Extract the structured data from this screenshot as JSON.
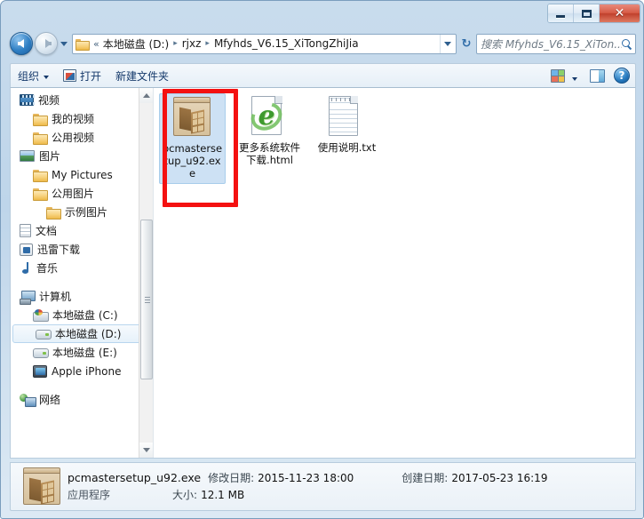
{
  "window": {
    "buttons": {
      "minimize": "–",
      "maximize": "□",
      "close": "✕"
    }
  },
  "address": {
    "back_tooltip": "后退",
    "forward_tooltip": "前进",
    "separator_first": "«",
    "separator": "▸",
    "crumbs": [
      "本地磁盘 (D:)",
      "rjxz",
      "Mfyhds_V6.15_XiTongZhiJia"
    ],
    "refresh": "↻"
  },
  "search": {
    "placeholder": "搜索 Mfyhds_V6.15_XiTon..."
  },
  "toolbar": {
    "organize": "组织",
    "open": "打开",
    "new_folder": "新建文件夹"
  },
  "sidebar": {
    "items": [
      {
        "label": "视频",
        "icon": "video-icon",
        "indent": 0,
        "selected": false
      },
      {
        "label": "我的视频",
        "icon": "folder-icon",
        "indent": 1,
        "selected": false
      },
      {
        "label": "公用视频",
        "icon": "folder-icon",
        "indent": 1,
        "selected": false
      },
      {
        "label": "图片",
        "icon": "pictures-icon",
        "indent": 0,
        "selected": false
      },
      {
        "label": "My Pictures",
        "icon": "folder-icon",
        "indent": 1,
        "selected": false
      },
      {
        "label": "公用图片",
        "icon": "folder-icon",
        "indent": 1,
        "selected": false
      },
      {
        "label": "示例图片",
        "icon": "folder-icon",
        "indent": 2,
        "selected": false
      },
      {
        "label": "文档",
        "icon": "document-icon",
        "indent": 0,
        "selected": false
      },
      {
        "label": "迅雷下载",
        "icon": "download-icon",
        "indent": 0,
        "selected": false
      },
      {
        "label": "音乐",
        "icon": "music-icon",
        "indent": 0,
        "selected": false
      },
      {
        "label": "计算机",
        "icon": "computer-icon",
        "indent": 0,
        "selected": false,
        "gap_before": true
      },
      {
        "label": "本地磁盘 (C:)",
        "icon": "system-drive-icon",
        "indent": 1,
        "selected": false
      },
      {
        "label": "本地磁盘 (D:)",
        "icon": "drive-icon",
        "indent": 1,
        "selected": true
      },
      {
        "label": "本地磁盘 (E:)",
        "icon": "drive-icon",
        "indent": 1,
        "selected": false
      },
      {
        "label": "Apple iPhone",
        "icon": "iphone-icon",
        "indent": 1,
        "selected": false
      },
      {
        "label": "网络",
        "icon": "network-icon",
        "indent": 0,
        "selected": false,
        "gap_before": true
      }
    ]
  },
  "files": [
    {
      "name": "pcmastersetup_u92.exe",
      "icon": "exe-icon",
      "selected": true
    },
    {
      "name": "更多系统软件下载.html",
      "icon": "html-icon",
      "selected": false
    },
    {
      "name": "使用说明.txt",
      "icon": "txt-icon",
      "selected": false
    }
  ],
  "status": {
    "file_name": "pcmastersetup_u92.exe",
    "file_type": "应用程序",
    "modified_label": "修改日期:",
    "modified_value": "2015-11-23 18:00",
    "created_label": "创建日期:",
    "created_value": "2017-05-23 16:19",
    "size_label": "大小:",
    "size_value": "12.1 MB"
  },
  "colors": {
    "annotation_red": "#f41111",
    "selection_blue": "#cde1f4",
    "close_button_red": "#c0402c"
  }
}
